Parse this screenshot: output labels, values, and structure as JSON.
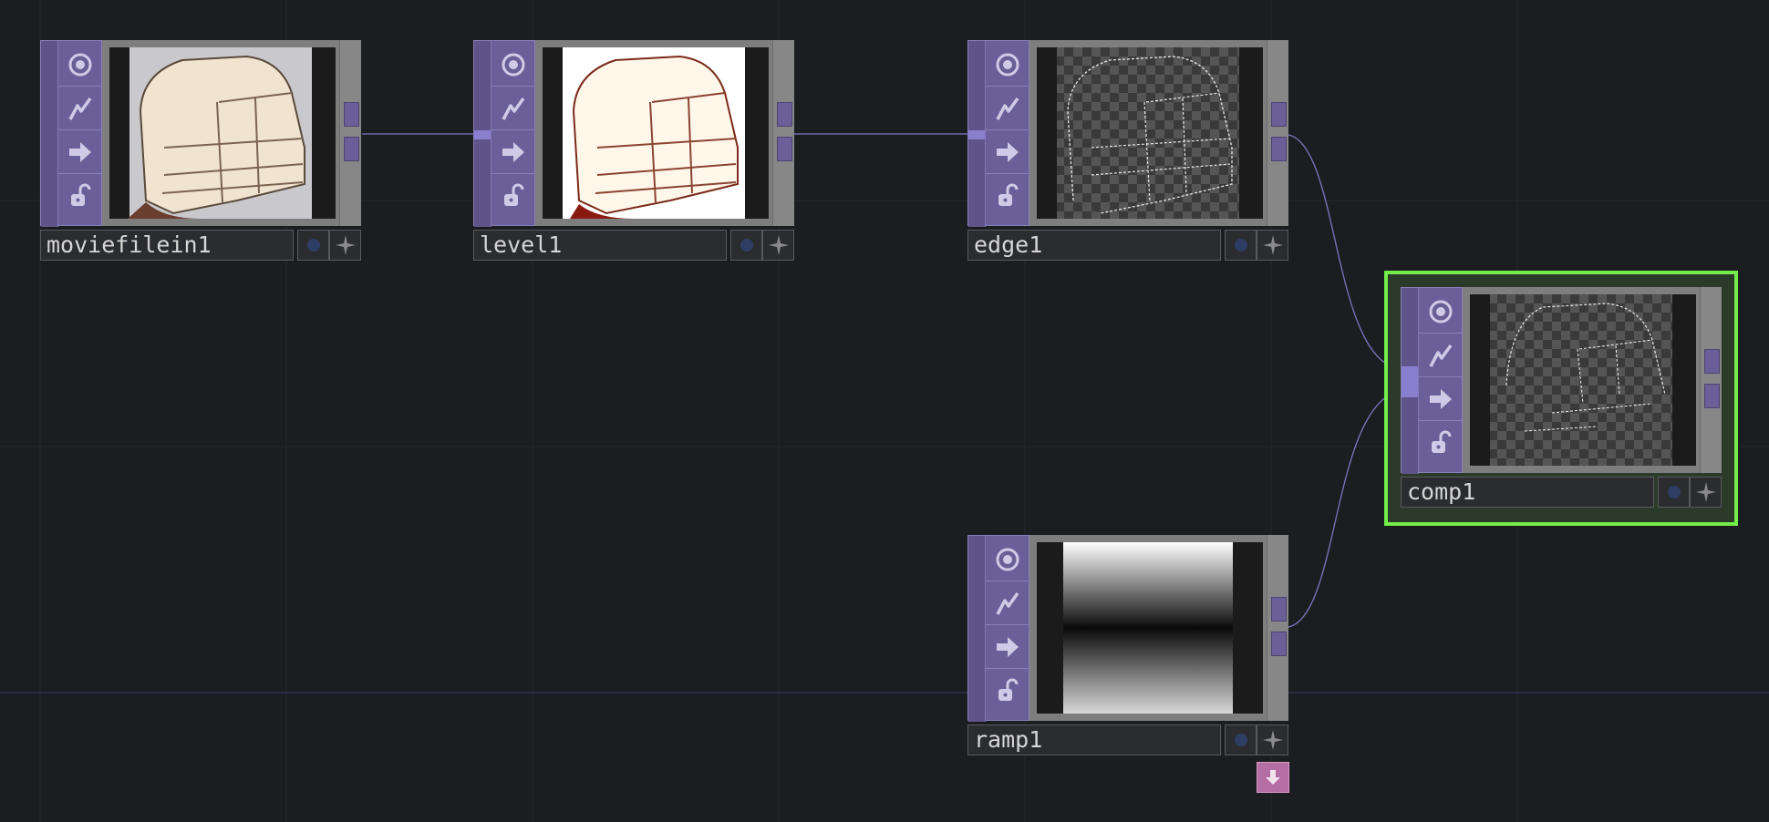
{
  "nodes": {
    "moviefilein": {
      "name": "moviefilein1"
    },
    "level": {
      "name": "level1"
    },
    "edge": {
      "name": "edge1"
    },
    "comp": {
      "name": "comp1"
    },
    "ramp": {
      "name": "ramp1"
    }
  },
  "icons": {
    "flags": [
      "display-flag-icon",
      "cooking-flag-icon",
      "render-flag-icon",
      "lock-flag-icon"
    ],
    "label_buttons": [
      "viewer-toggle-icon",
      "bypass-icon"
    ],
    "extra": "arrow-down-icon"
  },
  "colors": {
    "background": "#1c1d21",
    "top_family": "#6a5f98",
    "selection": "#74ee4a",
    "wire": "#7f76c0",
    "down_button": "#b46ea4"
  }
}
